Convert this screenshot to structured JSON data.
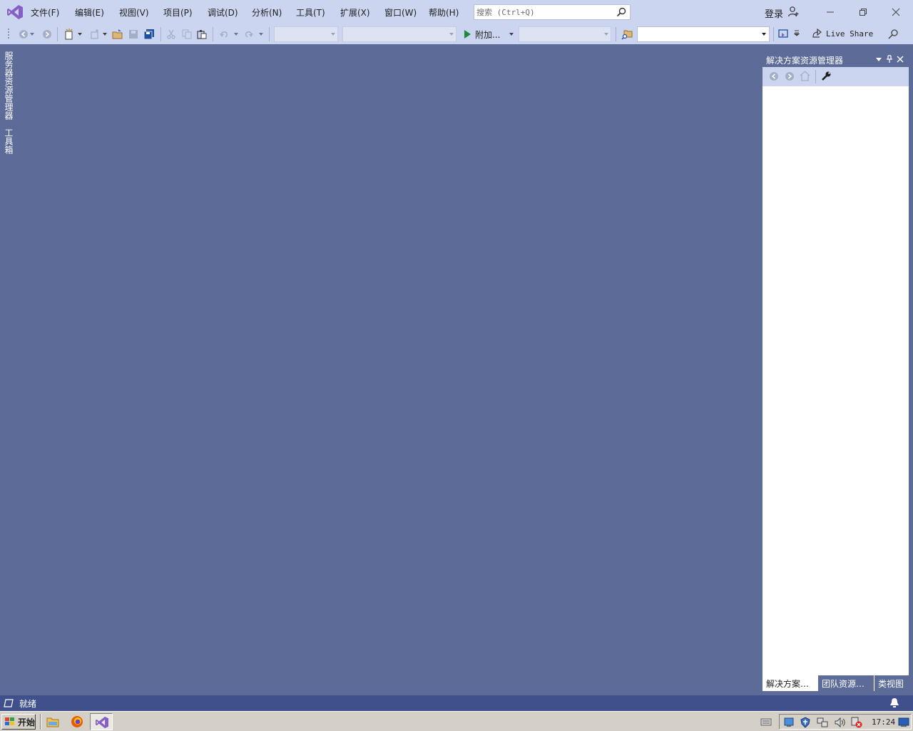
{
  "menu": {
    "file": "文件(F)",
    "edit": "编辑(E)",
    "view": "视图(V)",
    "project": "项目(P)",
    "debug": "调试(D)",
    "analyze": "分析(N)",
    "tools": "工具(T)",
    "extensions": "扩展(X)",
    "window": "窗口(W)",
    "help": "帮助(H)"
  },
  "search": {
    "placeholder": "搜索 (Ctrl+Q)"
  },
  "account": {
    "login": "登录"
  },
  "toolbar": {
    "attach": "附加...",
    "live_share": "Live Share"
  },
  "left_tabs": {
    "server_explorer": "服务器资源管理器",
    "toolbox": "工具箱"
  },
  "solution_explorer": {
    "title": "解决方案资源管理器",
    "tabs": [
      "解决方案…",
      "团队资源…",
      "类视图"
    ]
  },
  "status": {
    "text": "就绪"
  },
  "taskbar": {
    "start": "开始",
    "clock": "17:24"
  },
  "colors": {
    "chrome": "#ccd5f0",
    "workspace": "#5c6b98",
    "statusbar": "#40508d",
    "accent_purple": "#865fc5"
  }
}
